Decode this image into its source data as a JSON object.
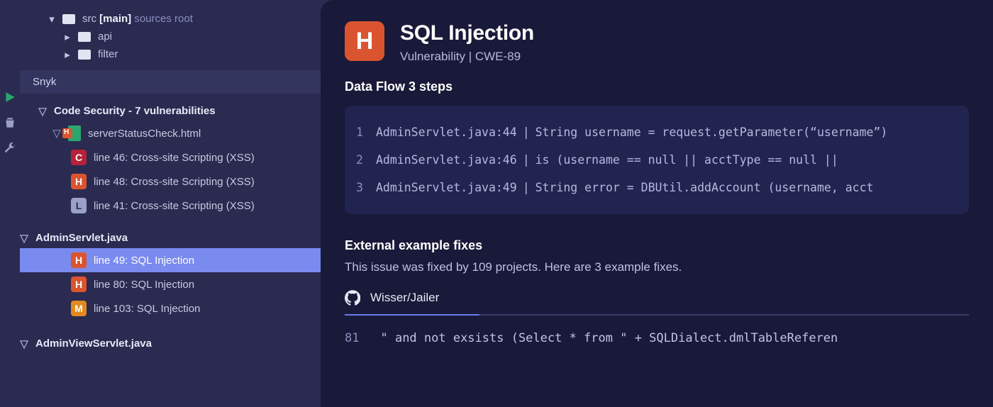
{
  "fileTree": {
    "root": {
      "name": "src",
      "branch": "[main]",
      "suffix": "sources root"
    },
    "children": [
      {
        "name": "api"
      },
      {
        "name": "filter"
      }
    ]
  },
  "panelTitle": "Snyk",
  "tree": {
    "group0Label": "Code Security - 7 vulnerabilities",
    "file0": {
      "name": "serverStatusCheck.html",
      "issues": [
        {
          "sev": "C",
          "label": "line 46: Cross-site Scripting (XSS)"
        },
        {
          "sev": "H",
          "label": "line 48: Cross-site Scripting (XSS)"
        },
        {
          "sev": "L",
          "label": "line 41: Cross-site Scripting (XSS)"
        }
      ]
    },
    "file1": {
      "name": "AdminServlet.java",
      "issues": [
        {
          "sev": "H",
          "label": "line 49: SQL Injection",
          "selected": true
        },
        {
          "sev": "H",
          "label": "line 80: SQL Injection"
        },
        {
          "sev": "M",
          "label": "line 103: SQL Injection"
        }
      ]
    },
    "file2": {
      "name": "AdminViewServlet.java"
    }
  },
  "detail": {
    "badge": "H",
    "title": "SQL Injection",
    "subtitle": "Vulnerability | CWE-89",
    "flowHeader": "Data Flow 3 steps",
    "flow": [
      {
        "n": "1",
        "loc": "AdminServlet.java:44",
        "code": "String username = request.getParameter(“username”)"
      },
      {
        "n": "2",
        "loc": "AdminServlet.java:46",
        "code": "is (username == null || acctType == null ||"
      },
      {
        "n": "3",
        "loc": "AdminServlet.java:49",
        "code": "String error = DBUtil.addAccount (username, acct"
      }
    ],
    "extHeader": "External example fixes",
    "extSub": "This issue was fixed by 109 projects. Here are 3 example fixes.",
    "repo": "Wisser/Jailer",
    "codeLine": {
      "n": "81",
      "text": "\" and not exsists (Select * from \" + SQLDialect.dmlTableReferen"
    }
  }
}
